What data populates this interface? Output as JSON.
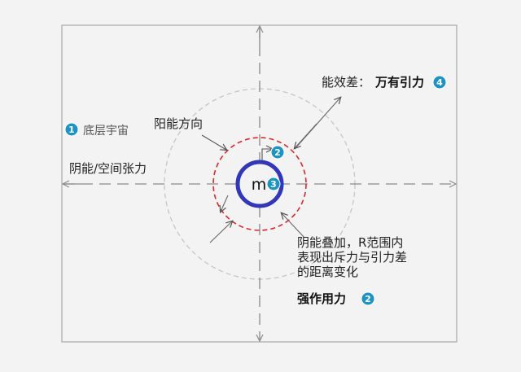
{
  "labels": {
    "base_universe": "底层宇宙",
    "yin_energy_space_tension": "阴能/空间张力",
    "yin_energy_direction": "阳能方向",
    "energy_diff": "能效差：",
    "universal_gravity": "万有引力",
    "yin_superposition_line1": "阴能叠加，R范围内",
    "yin_superposition_line2": "表现出斥力与引力差",
    "yin_superposition_line3": "的距离变化",
    "strong_force": "强作用力",
    "mass": "m"
  },
  "badges": {
    "base_universe": "1",
    "inner_ring": "2",
    "mass": "3",
    "gravity": "4",
    "strong_force": "2"
  },
  "colors": {
    "badge_fill": "#1b94c4",
    "inner_ring": "#d9292b",
    "mass_ring": "#3236b8",
    "outer_ring": "#c6c6c6",
    "axes": "#8a8a8a",
    "frame": "#a9a9a9"
  }
}
